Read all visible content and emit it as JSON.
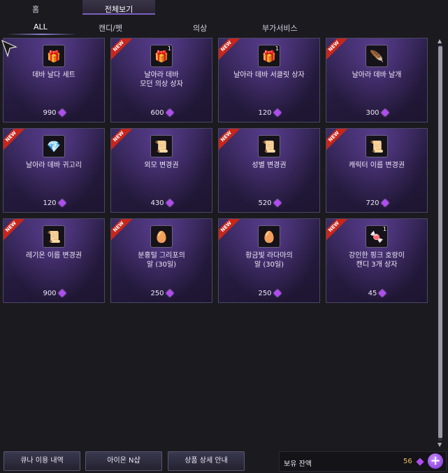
{
  "top_tabs": [
    {
      "label": "홈"
    },
    {
      "label": "전체보기"
    }
  ],
  "sub_tabs": [
    {
      "label": "ALL"
    },
    {
      "label": "캔디/펫"
    },
    {
      "label": "의상"
    },
    {
      "label": "부가서비스"
    }
  ],
  "items": [
    {
      "name": "데바 날다 세트",
      "price": "990",
      "new": false,
      "icon": "gift-set-icon"
    },
    {
      "name": "날아라 데바\n모던 의상 상자",
      "price": "600",
      "new": true,
      "icon": "gift-box-icon",
      "qty": "1"
    },
    {
      "name": "날아라 데바 서클릿 상자",
      "price": "120",
      "new": true,
      "icon": "gift-box-icon",
      "qty": "1"
    },
    {
      "name": "날아라 데바 날개",
      "price": "300",
      "new": true,
      "icon": "wing-icon"
    },
    {
      "name": "날아라 데바 귀고리",
      "price": "120",
      "new": true,
      "icon": "earring-icon"
    },
    {
      "name": "외모 변경권",
      "price": "430",
      "new": true,
      "icon": "ticket-icon"
    },
    {
      "name": "성별 변경권",
      "price": "520",
      "new": true,
      "icon": "ticket-icon"
    },
    {
      "name": "캐릭터 이름 변경권",
      "price": "720",
      "new": true,
      "icon": "ticket-icon"
    },
    {
      "name": "레기온 이름 변경권",
      "price": "900",
      "new": true,
      "icon": "ticket-icon"
    },
    {
      "name": "분홍털 그리포의\n알 (30일)",
      "price": "250",
      "new": true,
      "icon": "egg-icon"
    },
    {
      "name": "황금빛 라다마의\n알 (30일)",
      "price": "250",
      "new": true,
      "icon": "egg-icon"
    },
    {
      "name": "강인한 핑크 호랑이\n캔디 3개 상자",
      "price": "45",
      "new": true,
      "icon": "candy-box-icon",
      "qty": "1"
    }
  ],
  "new_badge": "NEW",
  "buttons": {
    "history": "큐나 이용 내역",
    "aion_n": "아이온 N샵",
    "detail": "상품 상세 안내"
  },
  "balance": {
    "label": "보유 잔액",
    "amount": "56"
  },
  "colors": {
    "gem": "#b04cf0",
    "new_ribbon": "#c8261b",
    "card_bg": "#2e2250"
  }
}
